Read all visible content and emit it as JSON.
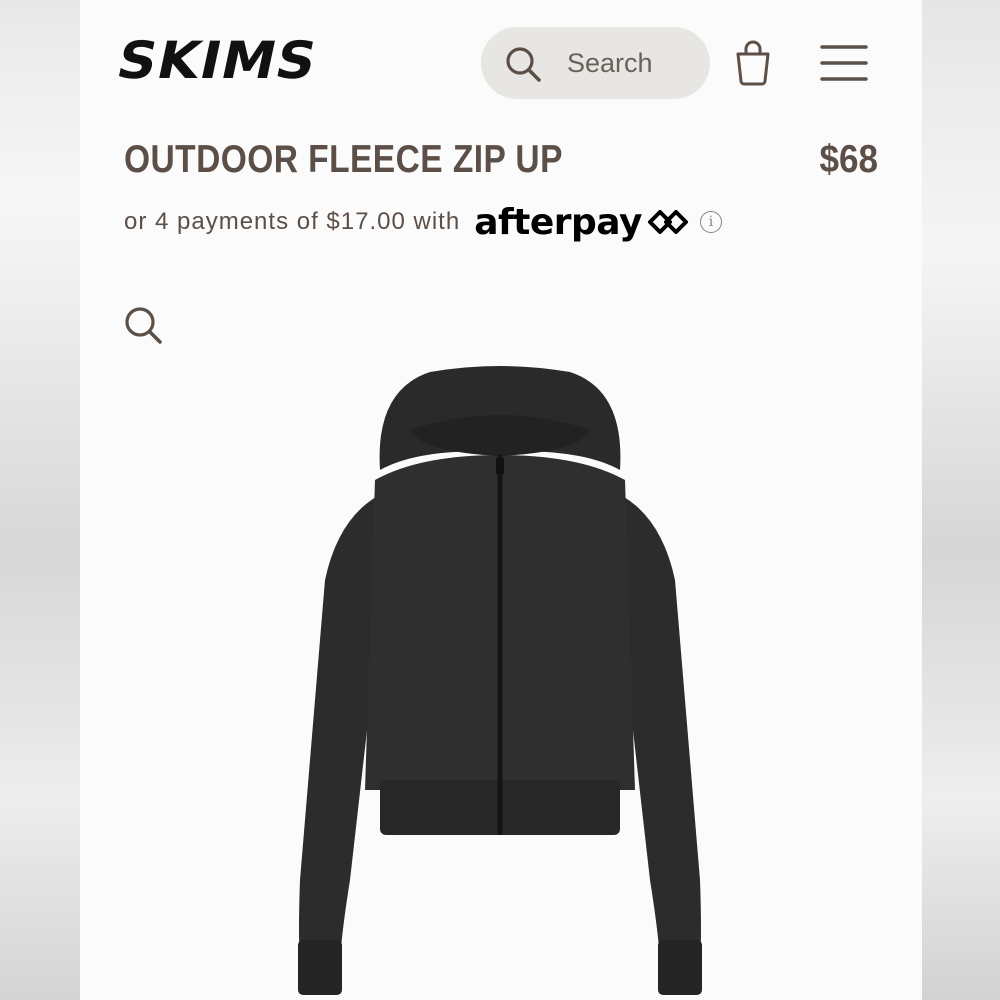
{
  "header": {
    "logo_text": "SKIMS",
    "search": {
      "placeholder": "Search",
      "icon": "search-icon"
    },
    "bag_icon": "shopping-bag-icon",
    "menu_icon": "hamburger-menu-icon"
  },
  "product": {
    "title": "OUTDOOR FLEECE ZIP UP",
    "price": "$68",
    "installments": {
      "text": "or 4 payments of $17.00 with",
      "provider": "afterpay",
      "info_icon": "info-icon"
    },
    "zoom_icon": "zoom-icon",
    "image_alt": "black cropped zip-up hoodie"
  },
  "colors": {
    "text_brown": "#5b4f47",
    "search_bg": "#e8e6e3",
    "garment": "#2f2e2e"
  }
}
